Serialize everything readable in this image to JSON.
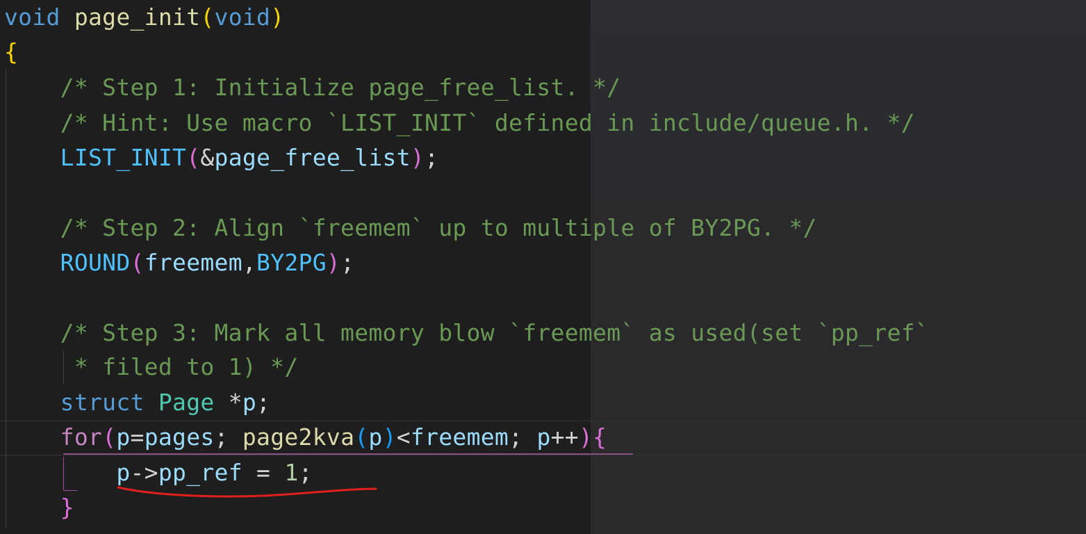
{
  "code_lines": [
    "void page_init(void)",
    "{",
    "    /* Step 1: Initialize page_free_list. */",
    "    /* Hint: Use macro `LIST_INIT` defined in include/queue.h. */",
    "    LIST_INIT(&page_free_list);",
    "",
    "    /* Step 2: Align `freemem` up to multiple of BY2PG. */",
    "    ROUND(freemem,BY2PG);",
    "",
    "    /* Step 3: Mark all memory blow `freemem` as used(set `pp_ref`",
    "     * filed to 1) */",
    "    struct Page *p;",
    "    for(p=pages; page2kva(p)<freemem; p++){",
    "        p->pp_ref = 1;",
    "    }"
  ],
  "tokens": {
    "l1": {
      "kw_void": "void",
      "fn_name": "page_init",
      "lp": "(",
      "param": "void",
      "rp": ")"
    },
    "l2": {
      "brace": "{"
    },
    "l3": {
      "comment": "/* Step 1: Initialize page_free_list. */"
    },
    "l4": {
      "comment": "/* Hint: Use macro `LIST_INIT` defined in include/queue.h. */"
    },
    "l5": {
      "macro": "LIST_INIT",
      "lp": "(",
      "amp": "&",
      "var": "page_free_list",
      "rp": ")",
      "semi": ";"
    },
    "l7": {
      "comment": "/* Step 2: Align `freemem` up to multiple of BY2PG. */"
    },
    "l8": {
      "macro": "ROUND",
      "lp": "(",
      "arg1": "freemem",
      "comma": ",",
      "arg2": "BY2PG",
      "rp": ")",
      "semi": ";"
    },
    "l10": {
      "comment": "/* Step 3: Mark all memory blow `freemem` as used(set `pp_ref`"
    },
    "l11": {
      "comment": " * filed to 1) */"
    },
    "l12": {
      "kw_struct": "struct",
      "type": "Page",
      "star": "*",
      "var": "p",
      "semi": ";"
    },
    "l13": {
      "kw_for": "for",
      "lp": "(",
      "p1": "p",
      "eq": "=",
      "pages": "pages",
      "semi1": "; ",
      "fn": "page2kva",
      "lp2": "(",
      "p2": "p",
      "rp2": ")",
      "lt": "<",
      "freemem": "freemem",
      "semi2": "; ",
      "p3": "p",
      "inc": "++",
      "rp": ")",
      "brace": "{"
    },
    "l14": {
      "p": "p",
      "arrow": "->",
      "field": "pp_ref",
      "eq": " = ",
      "num": "1",
      "semi": ";"
    },
    "l15": {
      "brace": "}"
    }
  },
  "annotation": {
    "color": "#e0201c",
    "shape": "freehand-underline",
    "target": "p->pp_ref = 1;"
  },
  "colors": {
    "background": "#1e1e1e",
    "keyword": "#569cd6",
    "function": "#dcdcaa",
    "comment": "#6a9955",
    "macro": "#4fc1ff",
    "variable": "#9cdcfe",
    "type": "#4ec9b0",
    "control": "#c586c0",
    "number": "#b5cea8"
  }
}
